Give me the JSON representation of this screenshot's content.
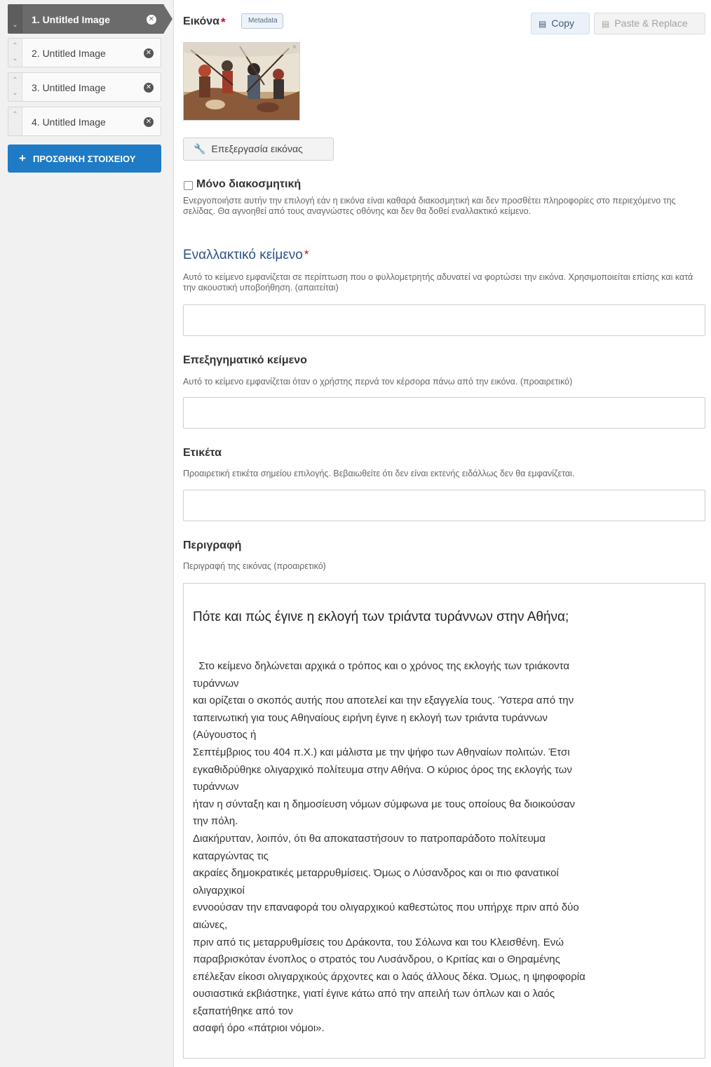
{
  "sidebar": {
    "items": [
      {
        "label": "1. Untitled Image",
        "active": true
      },
      {
        "label": "2. Untitled Image",
        "active": false
      },
      {
        "label": "3. Untitled Image",
        "active": false
      },
      {
        "label": "4. Untitled Image",
        "active": false
      }
    ],
    "add_button": "ΠΡΟΣΘΗΚΗ ΣΤΟΙΧΕΙΟΥ"
  },
  "image_field": {
    "label": "Εικόνα",
    "metadata_tag": "Metadata",
    "copy_button": "Copy",
    "paste_button": "Paste & Replace",
    "edit_image_button": "Επεξεργασία εικόνας"
  },
  "decorative": {
    "label": "Μόνο διακοσμητική",
    "checked": false,
    "help": "Ενεργοποιήστε αυτήν την επιλογή εάν η εικόνα είναι καθαρά διακοσμητική και δεν προσθέτει πληροφορίες στο περιεχόμενο της σελίδας. Θα αγνοηθεί από τους αναγνώστες οθόνης και δεν θα δοθεί εναλλακτικό κείμενο."
  },
  "alt_text": {
    "label": "Εναλλακτικό κείμενο",
    "help": "Αυτό το κείμενο εμφανίζεται σε περίπτωση που ο φυλλομετρητής αδυνατεί να φορτώσει την εικόνα. Χρησιμοποιείται επίσης και κατά την ακουστική υποβοήθηση. (απαιτείται)",
    "value": ""
  },
  "hover_text": {
    "label": "Επεξηγηματικό κείμενο",
    "help": "Αυτό το κείμενο εμφανίζεται όταν ο χρήστης περνά τον κέρσορα πάνω από την εικόνα. (προαιρετικό)",
    "value": ""
  },
  "tag": {
    "label": "Ετικέτα",
    "help": "Προαιρετική ετικέτα σημείου επιλογής. Βεβαιωθείτε ότι δεν είναι εκτενής ειδάλλως δεν θα εμφανίζεται.",
    "value": ""
  },
  "description": {
    "label": "Περιγραφή",
    "help": "Περιγραφή της εικόνας (προαιρετικό)",
    "heading": "Πότε και πώς έγινε η εκλογή των τριάντα τυράννων στην Αθήνα;",
    "lines": [
      "  Στο κείμενο δηλώνεται αρχικά ο τρόπος και ο χρόνος της εκλογής των τριάκοντα",
      "τυράννων",
      "και ορίζεται ο σκοπός αυτής που αποτελεί και την εξαγγελία τους. Ύστερα από την",
      "ταπεινωτική για τους Αθηναίους ειρήνη έγινε η εκλογή των τριάντα τυράννων",
      "(Αύγουστος ή",
      "Σεπτέμβριος του 404 π.Χ.) και μάλιστα με την ψήφο των Αθηναίων πολιτών. Έτσι",
      "εγκαθιδρύθηκε ολιγαρχικό πολίτευμα στην Αθήνα. Ο κύριος όρος της εκλογής των",
      "τυράννων",
      "ήταν η σύνταξη και η δημοσίευση νόμων σύμφωνα με τους οποίους θα διοικούσαν",
      "την πόλη.",
      "Διακήρυτταν, λοιπόν, ότι θα αποκαταστήσουν το πατροπαράδοτο πολίτευμα",
      "καταργώντας τις",
      "ακραίες δημοκρατικές μεταρρυθμίσεις. Όμως ο Λύσανδρος και οι πιο φανατικοί",
      "ολιγαρχικοί",
      "εννοούσαν την επαναφορά του ολιγαρχικού καθεστώτος που υπήρχε πριν από δύο",
      "αιώνες,",
      "πριν από τις μεταρρυθμίσεις του Δράκοντα, του Σόλωνα και του Κλεισθένη. Ενώ",
      "παραβρισκόταν ένοπλος ο στρατός του Λυσάνδρου, ο Κριτίας και ο Θηραμένης",
      "επέλεξαν είκοσι ολιγαρχικούς άρχοντες και ο λαός άλλους δέκα. Όμως, η ψηφοφορία",
      "ουσιαστικά εκβιάστηκε, γιατί έγινε κάτω από την απειλή των όπλων και ο λαός",
      "εξαπατήθηκε από τον",
      "ασαφή όρο «πάτριοι νόμοι»."
    ]
  },
  "icons": {
    "remove": "remove-circle-icon",
    "drag_up": "chevron-up-icon",
    "drag_down": "chevron-down-icon",
    "copy": "clipboard-icon",
    "paste": "paste-icon",
    "edit": "wrench-icon"
  },
  "colors": {
    "accent": "#1f7bc6",
    "active_item": "#6b6b6b",
    "required": "#d0021b",
    "section_title": "#2b5288"
  }
}
